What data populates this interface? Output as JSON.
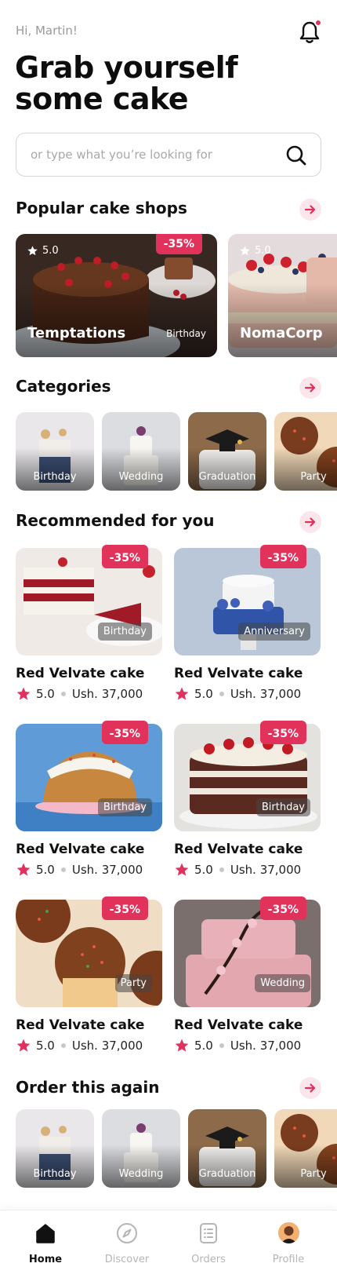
{
  "greeting": "Hi, Martin!",
  "headline": "Grab yourself some cake",
  "search": {
    "placeholder": "or type what you’re looking for"
  },
  "sections": {
    "popular": "Popular cake shops",
    "categories": "Categories",
    "recommended": "Recommended for you",
    "order_again": "Order this again"
  },
  "shops": [
    {
      "name": "Temptations",
      "rating": "5.0",
      "tag": "Birthday",
      "discount": "-35%"
    },
    {
      "name": "NomaCorp",
      "rating": "5.0"
    }
  ],
  "categories": [
    "Birthday",
    "Wedding",
    "Graduation",
    "Party"
  ],
  "recommended": [
    {
      "name": "Red Velvate cake",
      "rating": "5.0",
      "price": "Ush. 37,000",
      "tag": "Birthday",
      "discount": "-35%"
    },
    {
      "name": "Red Velvate cake",
      "rating": "5.0",
      "price": "Ush. 37,000",
      "tag": "Anniversary",
      "discount": "-35%"
    },
    {
      "name": "Red Velvate cake",
      "rating": "5.0",
      "price": "Ush. 37,000",
      "tag": "Birthday",
      "discount": "-35%"
    },
    {
      "name": "Red Velvate cake",
      "rating": "5.0",
      "price": "Ush. 37,000",
      "tag": "Birthday",
      "discount": "-35%"
    },
    {
      "name": "Red Velvate cake",
      "rating": "5.0",
      "price": "Ush. 37,000",
      "tag": "Party",
      "discount": "-35%"
    },
    {
      "name": "Red Velvate cake",
      "rating": "5.0",
      "price": "Ush. 37,000",
      "tag": "Wedding",
      "discount": "-35%"
    }
  ],
  "order_again": [
    "Birthday",
    "Wedding",
    "Graduation",
    "Party"
  ],
  "tabs": [
    {
      "label": "Home",
      "icon": "home-icon",
      "active": true
    },
    {
      "label": "Discover",
      "icon": "compass-icon"
    },
    {
      "label": "Orders",
      "icon": "orders-icon"
    },
    {
      "label": "Profile",
      "icon": "avatar"
    }
  ],
  "colors": {
    "accent": "#e0325a",
    "accent_soft": "#fbe6ec",
    "muted": "#b5b5b5"
  }
}
